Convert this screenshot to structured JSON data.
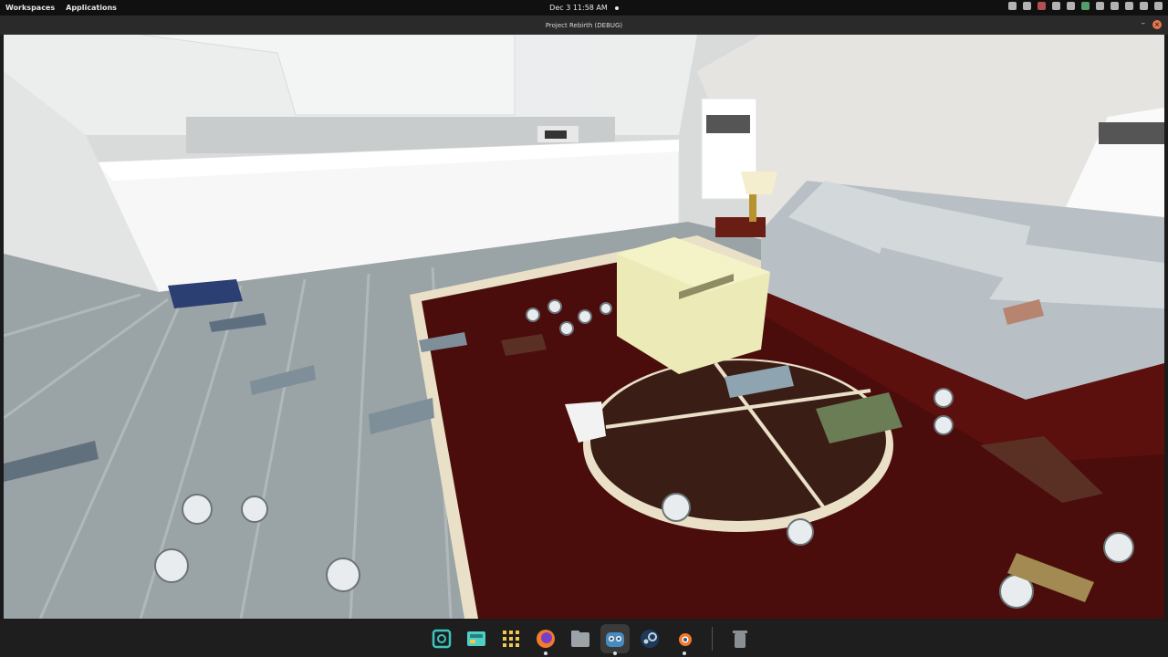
{
  "topbar": {
    "workspaces": "Workspaces",
    "applications": "Applications",
    "datetime": "Dec 3  11:58 AM"
  },
  "window": {
    "title": "Project Rebirth (DEBUG)",
    "minimize": "–",
    "close": "×"
  },
  "dock": {
    "apps": [
      {
        "name": "app-search-icon",
        "active": false
      },
      {
        "name": "desktop-icon",
        "active": false
      },
      {
        "name": "app-grid-icon",
        "active": false
      },
      {
        "name": "firefox-icon",
        "active": false
      },
      {
        "name": "files-icon",
        "active": false
      },
      {
        "name": "godot-icon",
        "active": true
      },
      {
        "name": "steam-icon",
        "active": false
      },
      {
        "name": "blender-icon",
        "active": false
      }
    ],
    "trash": "trash-icon"
  },
  "colors": {
    "rug": "#4a0d0b",
    "rug_border": "#eae0c8",
    "table": "#3a1e15",
    "box": "#ecebb8",
    "floor": "#9aa3a6",
    "sofa": "#b9c0c5",
    "wall": "#e6e7e6"
  }
}
